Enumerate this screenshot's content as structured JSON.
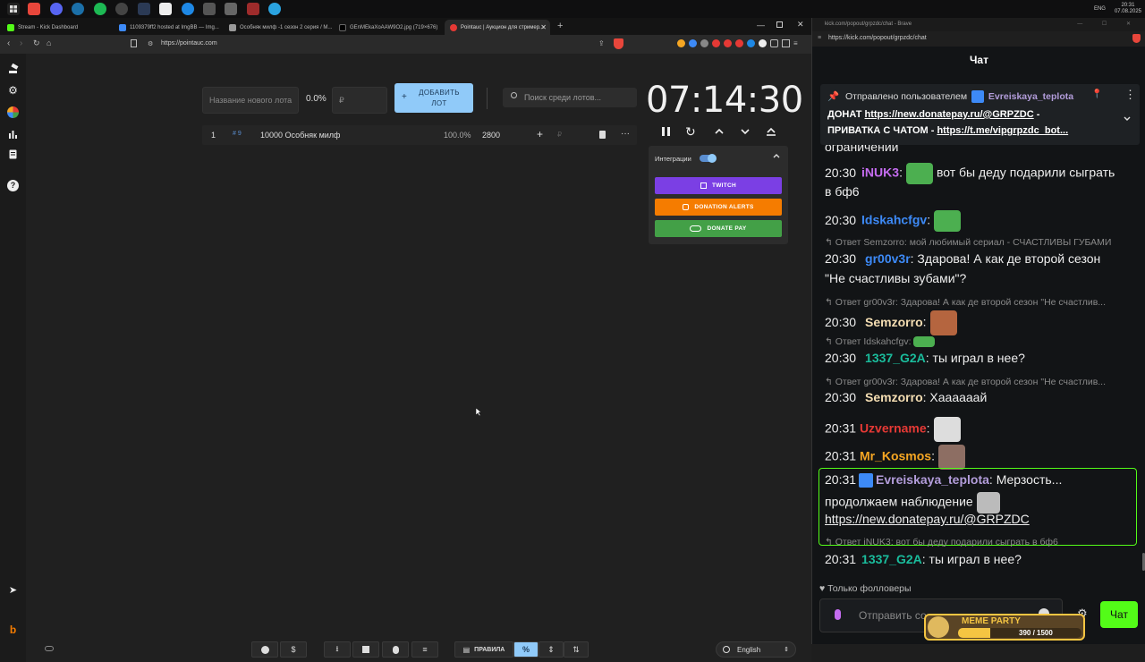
{
  "taskbar": {
    "clock_time": "20:31",
    "clock_date": "07.08.2025",
    "lang": "ENG"
  },
  "tabs": [
    {
      "label": "Stream - Kick Dashboard",
      "color": "#53fc18"
    },
    {
      "label": "1109379ff2 hosted at ImgBB — Img...",
      "color": "#3d8af7"
    },
    {
      "label": "Особняк милф -1 сезон 2 серия / M...",
      "color": "#cccccc"
    },
    {
      "label": "GEnMEkaXoAAW9O2.jpg (719×676)",
      "color": "#000000"
    },
    {
      "label": "Pointauc | Аукцион для стример...",
      "color": "#e53935"
    }
  ],
  "address": {
    "url": "https://pointauc.com"
  },
  "app": {
    "new_lot_placeholder": "Название нового лота",
    "percent": "0.0%",
    "price_placeholder": "₽",
    "add_lot_label": "ДОБАВИТЬ ЛОТ",
    "add_plus": "+",
    "search_placeholder": "Поиск среди лотов...",
    "timer": "07:14:30",
    "lot": {
      "index": "1",
      "id": "# 9",
      "name": "10000 Особняк милф",
      "percent": "100.0%",
      "amount": "2800",
      "plus": "+",
      "currency": "₽",
      "more": "···"
    },
    "integrations": {
      "label": "Интеграции",
      "twitch": "TWITCH",
      "donation_alerts": "DONATION ALERTS",
      "donate_pay": "DONATE PAY",
      "twitch_color": "#7b3fe4",
      "da_color": "#f57c00",
      "dp_color": "#43a047"
    },
    "bottom": {
      "rules_label": "ПРАВИЛА",
      "percent_label": "%",
      "language": "English"
    }
  },
  "chat": {
    "window_url_top": "kick.com/popout/grpzdc/chat - Brave",
    "url": "https://kick.com/popout/grpzdc/chat",
    "title": "Чат",
    "pinned_by": "Отправлено пользователем",
    "pinned_user": "Evreiskaya_teplota",
    "pinned_line1_prefix": "ДОНАТ ",
    "pinned_link1": "https://new.donatepay.ru/@GRPZDC",
    "pinned_line1_suffix": " -",
    "pinned_line2_prefix": "ПРИВАТКА С ЧАТОМ - ",
    "pinned_link2": "https://t.me/vipgrpzdc_bot...",
    "cut_text": "ограничений",
    "messages": [
      {
        "time": "20:30",
        "user": "iNUK3",
        "color": "#c56cf0",
        "text": "вот бы деду подарили сыграть",
        "text2": "в бф6"
      },
      {
        "time": "20:30",
        "user": "Idskahcfgv",
        "color": "#3d8af7",
        "text": ""
      },
      {
        "reply": "Ответ Semzorro: мой любимый сериал - СЧАСТЛИВЫ ГУБАМИ",
        "time": "20:30",
        "user": "gr00v3r",
        "color": "#3d8af7",
        "text": "Здарова! А как де второй сезон",
        "text2": "\"Не счастливы зубами\"?"
      },
      {
        "reply": "Ответ gr00v3r: Здарова! А как де второй сезон \"Не счастлив...",
        "time": "20:30",
        "user": "Semzorro",
        "color": "#f5deb3",
        "text": ""
      },
      {
        "reply": "Ответ Idskahcfgv:",
        "time": "20:30",
        "user": "1337_G2A",
        "color": "#1abc9c",
        "text": "ты играл в нее?"
      },
      {
        "reply": "Ответ gr00v3r: Здарова! А как де второй сезон \"Не счастлив...",
        "time": "20:30",
        "user": "Semzorro",
        "color": "#f5deb3",
        "text": "Хаааааай"
      },
      {
        "time": "20:31",
        "user": "Uzvername",
        "color": "#e53935",
        "text": ""
      },
      {
        "time": "20:31",
        "user": "Mr_Kosmos",
        "color": "#f5a623",
        "text": ""
      },
      {
        "time": "20:31",
        "user": "Evreiskaya_teplota",
        "color": "#b39ddb",
        "text": "Мерзость...",
        "text2": "продолжаем наблюдение",
        "link": "https://new.donatepay.ru/@GRPZDC"
      },
      {
        "reply": "Ответ iNUK3:  вот бы деду подарили сыграть в бф6",
        "time": "20:31",
        "user": "1337_G2A",
        "color": "#1abc9c",
        "text": "ты играл в нее?"
      }
    ],
    "followers_only": "Только фолловеры",
    "input_placeholder": "Отправить со...",
    "send_label": "Чат",
    "meme_party": "MEME PARTY",
    "meme_counter": "390 / 1500"
  }
}
